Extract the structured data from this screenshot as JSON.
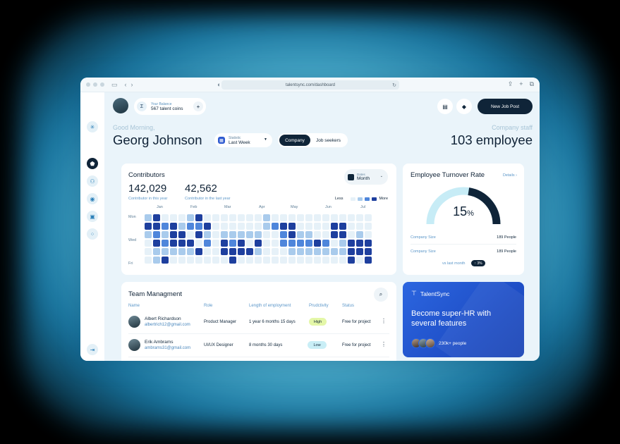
{
  "browser": {
    "url": "talentsync.com/dashboard"
  },
  "topbar": {
    "balance_label": "Your Balance",
    "balance_value": "567 talent coins",
    "new_job_label": "New Job Post"
  },
  "header": {
    "greeting": "Good Morning,",
    "name": "Georg Johnson",
    "statistic_label": "Statistic",
    "statistic_value": "Last Week",
    "segments": [
      "Company",
      "Job seekers"
    ],
    "active_segment": "Company",
    "staff_label": "Company staff",
    "staff_value": "103 employee"
  },
  "contributors": {
    "title": "Contributors",
    "this_year_value": "142,029",
    "this_year_label": "Contributor in this year",
    "last_year_value": "42,562",
    "last_year_label": "Contributor in the last year",
    "dates_label": "Dates",
    "dates_value": "Month",
    "legend_less": "Less",
    "legend_more": "More",
    "months": [
      "Jan",
      "Feb",
      "Mar",
      "Apr",
      "May",
      "Jun",
      "Jul"
    ],
    "row_labels": [
      "Mon",
      "Wed",
      "Fri"
    ],
    "colors": [
      "#e6f1f8",
      "#a9cbec",
      "#4f86db",
      "#1e3f9e"
    ],
    "levels": [
      [
        1,
        3,
        0,
        0,
        0,
        1,
        3,
        0,
        0,
        0,
        0,
        0,
        0,
        0,
        1,
        0,
        0,
        0,
        0,
        0,
        0,
        0,
        0,
        0,
        0,
        0,
        0
      ],
      [
        3,
        3,
        2,
        3,
        1,
        2,
        2,
        3,
        0,
        0,
        0,
        0,
        0,
        0,
        1,
        2,
        3,
        3,
        0,
        0,
        0,
        0,
        3,
        3,
        0,
        0,
        0
      ],
      [
        1,
        2,
        1,
        3,
        3,
        0,
        3,
        1,
        0,
        1,
        1,
        1,
        1,
        1,
        0,
        0,
        2,
        3,
        1,
        1,
        0,
        0,
        3,
        3,
        0,
        1,
        0
      ],
      [
        0,
        3,
        2,
        3,
        3,
        3,
        0,
        2,
        0,
        3,
        2,
        3,
        0,
        3,
        0,
        0,
        2,
        2,
        2,
        2,
        3,
        2,
        0,
        1,
        3,
        3,
        3
      ],
      [
        0,
        1,
        1,
        1,
        1,
        1,
        3,
        0,
        0,
        3,
        3,
        3,
        3,
        1,
        0,
        0,
        0,
        1,
        1,
        1,
        1,
        1,
        1,
        1,
        3,
        3,
        3
      ],
      [
        0,
        1,
        3,
        0,
        0,
        0,
        0,
        0,
        0,
        0,
        3,
        0,
        0,
        0,
        0,
        0,
        0,
        0,
        0,
        0,
        0,
        0,
        0,
        0,
        3,
        0,
        3
      ]
    ]
  },
  "turnover": {
    "title": "Employee Turnover Rate",
    "details_label": "Details",
    "rate_value": "15",
    "rate_unit": "%",
    "rate_fraction": 0.15,
    "rows": [
      {
        "label": "Company Size",
        "value": "189 People"
      },
      {
        "label": "Company Size",
        "value": "189 People"
      }
    ],
    "vs_label": "vs last month",
    "vs_badge": "↑ 3%"
  },
  "team": {
    "title": "Team Managment",
    "headers": [
      "Name",
      "Role",
      "Length of employment",
      "Prudctivity",
      "Status"
    ],
    "rows": [
      {
        "name": "Albert Richardson",
        "email": "albertrich12@gmail.com",
        "role": "Product Manager",
        "length": "1 year 6 months 15 days",
        "productivity": "High",
        "productivity_color": "#e4f7a8",
        "status": "Free for project"
      },
      {
        "name": "Erik Ambrams",
        "email": "ambrams31@gmail.com",
        "role": "UI/UX Designer",
        "length": "8 months 30 days",
        "productivity": "Low",
        "productivity_color": "#c9eef6",
        "status": "Free for project"
      }
    ]
  },
  "promo": {
    "brand": "TalentSync",
    "headline": "Become super-HR with several features",
    "people_count": "230k+ people"
  }
}
